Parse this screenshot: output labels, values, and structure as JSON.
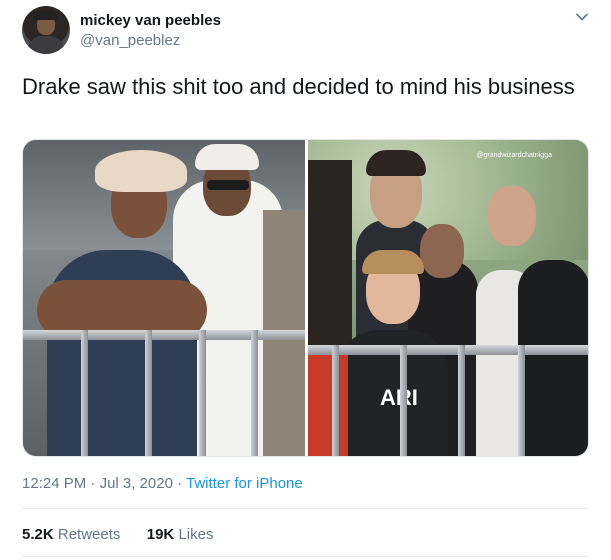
{
  "author": {
    "name": "mickey van peebles",
    "handle": "@van_peeblez"
  },
  "tweet": {
    "text": "Drake saw this shit too and decided to mind his business"
  },
  "media": {
    "watermark": "@grandwizardchatnigga",
    "shirt_text": "ARI"
  },
  "meta": {
    "time": "12:24 PM",
    "separator": " · ",
    "date": "Jul 3, 2020",
    "source": "Twitter for iPhone"
  },
  "stats": {
    "retweets_count": "5.2K",
    "retweets_label": "Retweets",
    "likes_count": "19K",
    "likes_label": "Likes"
  }
}
